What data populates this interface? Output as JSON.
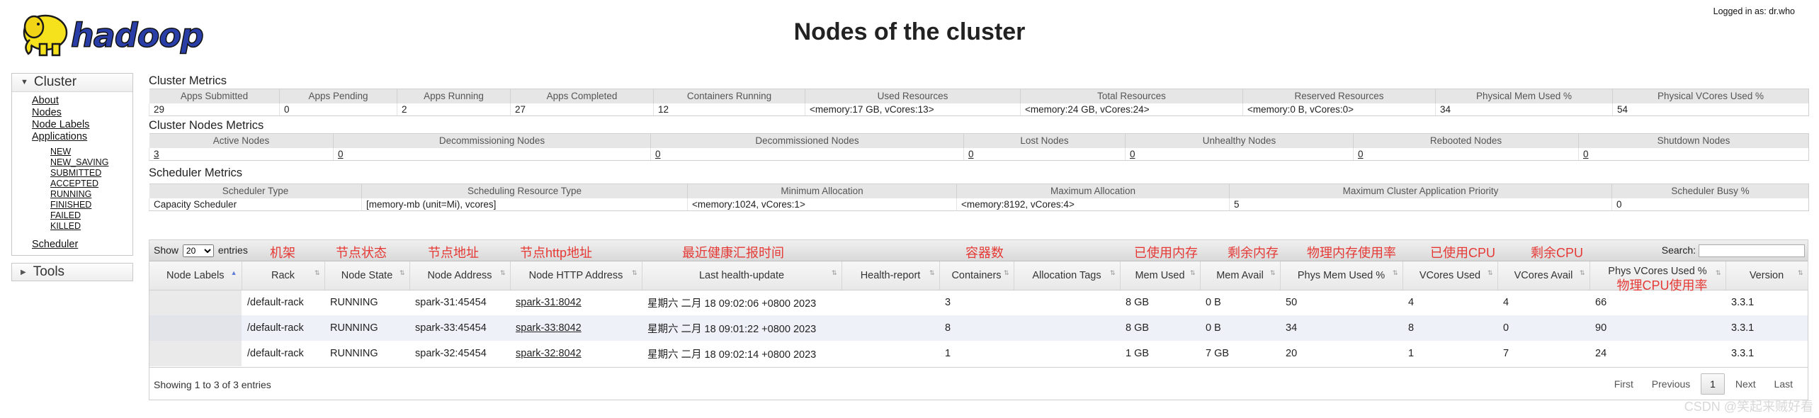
{
  "header": {
    "logo_text": "hadoop",
    "title": "Nodes of the cluster",
    "logged_in": "Logged in as: dr.who"
  },
  "sidebar": {
    "cluster_label": "Cluster",
    "links": [
      "About",
      "Nodes",
      "Node Labels",
      "Applications"
    ],
    "app_states": [
      "NEW",
      "NEW_SAVING",
      "SUBMITTED",
      "ACCEPTED",
      "RUNNING",
      "FINISHED",
      "FAILED",
      "KILLED"
    ],
    "scheduler_label": "Scheduler",
    "tools_label": "Tools"
  },
  "cluster_metrics": {
    "title": "Cluster Metrics",
    "headers": [
      "Apps Submitted",
      "Apps Pending",
      "Apps Running",
      "Apps Completed",
      "Containers Running",
      "Used Resources",
      "Total Resources",
      "Reserved Resources",
      "Physical Mem Used %",
      "Physical VCores Used %"
    ],
    "values": [
      "29",
      "0",
      "2",
      "27",
      "12",
      "<memory:17 GB, vCores:13>",
      "<memory:24 GB, vCores:24>",
      "<memory:0 B, vCores:0>",
      "34",
      "54"
    ]
  },
  "node_metrics": {
    "title": "Cluster Nodes Metrics",
    "headers": [
      "Active Nodes",
      "Decommissioning Nodes",
      "Decommissioned Nodes",
      "Lost Nodes",
      "Unhealthy Nodes",
      "Rebooted Nodes",
      "Shutdown Nodes"
    ],
    "values": [
      "3",
      "0",
      "0",
      "0",
      "0",
      "0",
      "0"
    ]
  },
  "scheduler_metrics": {
    "title": "Scheduler Metrics",
    "headers": [
      "Scheduler Type",
      "Scheduling Resource Type",
      "Minimum Allocation",
      "Maximum Allocation",
      "Maximum Cluster Application Priority",
      "Scheduler Busy %"
    ],
    "values": [
      "Capacity Scheduler",
      "[memory-mb (unit=Mi), vcores]",
      "<memory:1024, vCores:1>",
      "<memory:8192, vCores:4>",
      "5",
      "0"
    ]
  },
  "nodes_table": {
    "show_label": "Show",
    "entries_value": "20",
    "entries_label": "entries",
    "search_label": "Search:",
    "annotations": [
      "机架",
      "节点状态",
      "节点地址",
      "节点http地址",
      "最近健康汇报时间",
      "容器数",
      "已使用内存",
      "剩余内存",
      "物理内存使用率",
      "已使用CPU",
      "剩余CPU",
      "物理CPU使用率"
    ],
    "headers": [
      "Node Labels",
      "Rack",
      "Node State",
      "Node Address",
      "Node HTTP Address",
      "Last health-update",
      "Health-report",
      "Containers",
      "Allocation Tags",
      "Mem Used",
      "Mem Avail",
      "Phys Mem Used %",
      "VCores Used",
      "VCores Avail",
      "Phys VCores Used %",
      "Version"
    ],
    "rows": [
      [
        "",
        "/default-rack",
        "RUNNING",
        "spark-31:45454",
        "spark-31:8042",
        "星期六 二月 18 09:02:06 +0800 2023",
        "",
        "3",
        "",
        "8 GB",
        "0 B",
        "50",
        "4",
        "4",
        "66",
        "3.3.1"
      ],
      [
        "",
        "/default-rack",
        "RUNNING",
        "spark-33:45454",
        "spark-33:8042",
        "星期六 二月 18 09:01:22 +0800 2023",
        "",
        "8",
        "",
        "8 GB",
        "0 B",
        "34",
        "8",
        "0",
        "90",
        "3.3.1"
      ],
      [
        "",
        "/default-rack",
        "RUNNING",
        "spark-32:45454",
        "spark-32:8042",
        "星期六 二月 18 09:02:14 +0800 2023",
        "",
        "1",
        "",
        "1 GB",
        "7 GB",
        "20",
        "1",
        "7",
        "24",
        "3.3.1"
      ]
    ],
    "info": "Showing 1 to 3 of 3 entries",
    "pagination": [
      "First",
      "Previous",
      "1",
      "Next",
      "Last"
    ]
  },
  "watermark": "CSDN @笑起来贼好看",
  "colors": {
    "annotation": "#e53935",
    "header_bg": "#e6e6e6",
    "even_row": "#eef1f8"
  }
}
